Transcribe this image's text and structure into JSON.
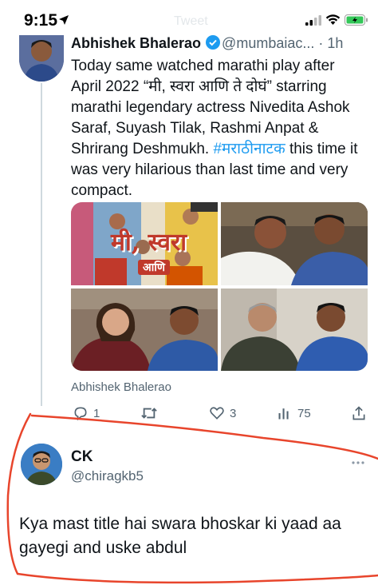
{
  "status_bar": {
    "time": "9:15",
    "ghost_title": "Tweet"
  },
  "tweet": {
    "author_name": "Abhishek Bhalerao",
    "author_handle": "@mumbaiac...",
    "age": "1h",
    "text_line_1": "Today same watched marathi play after",
    "text_line_2": "April 2022  “मी, स्वरा आणि ते दोघं” starring",
    "text_line_3": "marathi legendary actress Nivedita Ashok",
    "text_line_4": "Saraf, Suyash Tilak, Rashmi Anpat &",
    "text_line_5_pre": "Shrirang Deshmukh. ",
    "hashtag": "#मराठीनाटक",
    "text_line_5_post": "  this time it",
    "text_line_6": "was very hilarious than last time and very",
    "text_line_7": "compact.",
    "poster_title": "मी, स्वरा",
    "poster_subtitle": "आणि",
    "attribution": "Abhishek Bhalerao",
    "counts": {
      "replies": "1",
      "retweets": "",
      "likes": "3",
      "views": "75"
    }
  },
  "reply": {
    "author_name": "CK",
    "author_handle": "@chiragkb5",
    "text_line_1": "Kya mast title hai swara bhoskar ki yaad aa",
    "text_line_2": "gayegi and uske abdul"
  },
  "colors": {
    "text": "#0f1419",
    "secondary": "#536471",
    "link": "#1d9bf0",
    "annotation": "#e8452c",
    "battery": "#34c759"
  }
}
